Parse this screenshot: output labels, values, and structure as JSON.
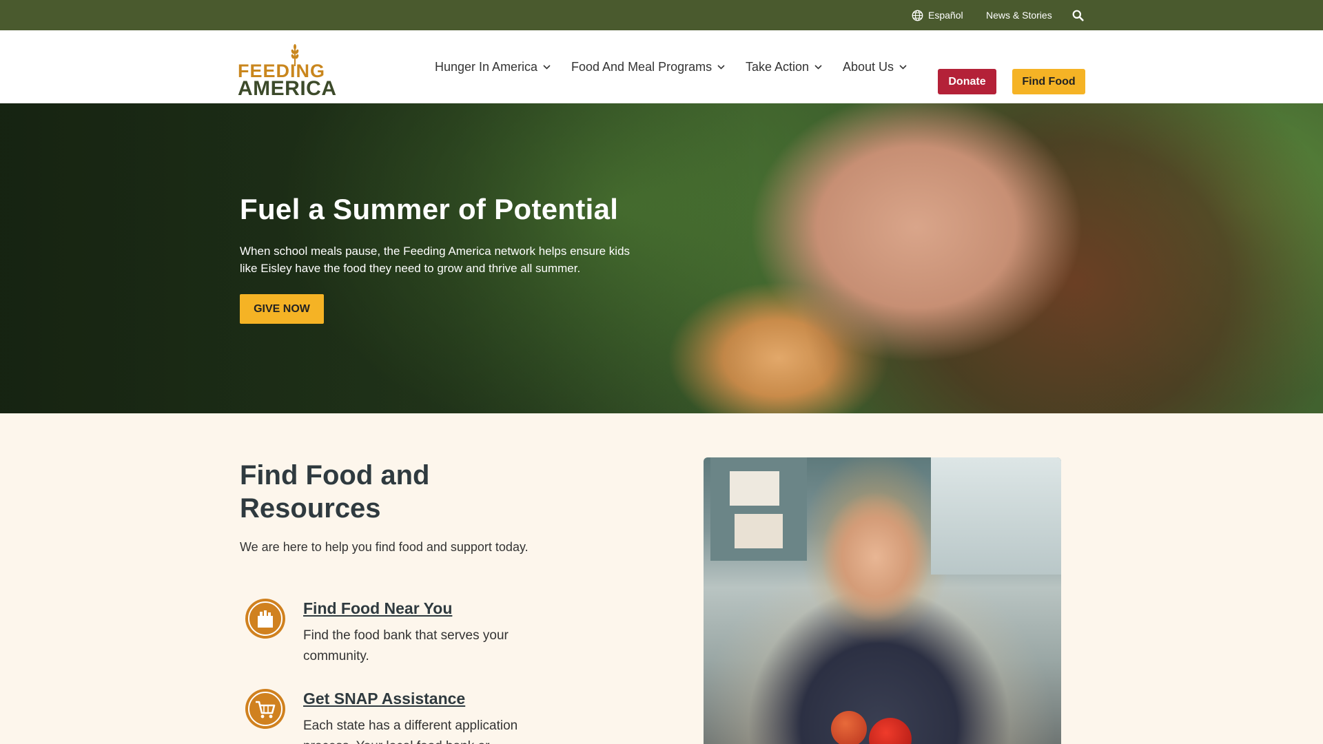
{
  "utility_bar": {
    "language_label": "Español",
    "news_label": "News & Stories",
    "background_color": "#4a5a2e"
  },
  "logo": {
    "line1": "FEEDING",
    "line2": "AMERICA"
  },
  "nav": {
    "items": [
      {
        "label": "Hunger In America"
      },
      {
        "label": "Food And Meal Programs"
      },
      {
        "label": "Take Action"
      },
      {
        "label": "About Us"
      }
    ],
    "donate_label": "Donate",
    "find_food_label": "Find Food",
    "donate_color": "#b42138",
    "find_food_color": "#f5b325"
  },
  "hero": {
    "title": "Fuel a Summer of Potential",
    "text": "When school meals pause, the Feeding America network helps ensure kids like Eisley have the food they need to grow and thrive all summer.",
    "cta_label": "GIVE NOW"
  },
  "resources": {
    "title": "Find Food and Resources",
    "subtitle": "We are here to help you find food and support today.",
    "items": [
      {
        "icon": "grocery-bag-icon",
        "title": "Find Food Near You",
        "text": "Find the food bank that serves your community."
      },
      {
        "icon": "shopping-cart-icon",
        "title": "Get SNAP Assistance",
        "text": "Each state has a different application process. Your local food bank or"
      }
    ],
    "accent_color": "#d0811f"
  }
}
